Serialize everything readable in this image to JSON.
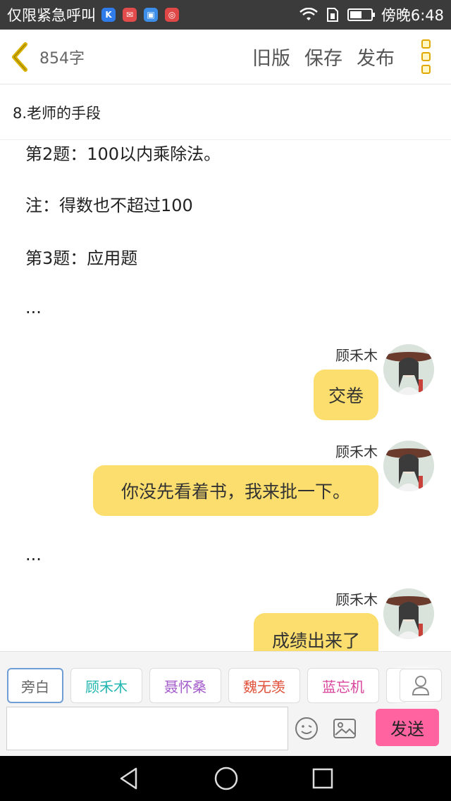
{
  "status_bar": {
    "carrier": "仅限紧急呼叫",
    "app_icons": [
      "k-app-icon",
      "mail-icon",
      "gallery-icon",
      "app-icon"
    ],
    "time": "傍晚6:48"
  },
  "toolbar": {
    "word_count": "854字",
    "old_version": "旧版",
    "save": "保存",
    "publish": "发布"
  },
  "chapter_title": "8.老师的手段",
  "content": {
    "lines": [
      "第2题：100以内乘除法。",
      "注：得数也不超过100",
      "第3题：应用题",
      "...",
      "..."
    ],
    "messages": [
      {
        "name": "顾禾木",
        "text": "交卷"
      },
      {
        "name": "顾禾木",
        "text": "你没先看着书，我来批一下。"
      },
      {
        "name": "顾禾木",
        "text": "成绩出来了"
      }
    ]
  },
  "roles": [
    {
      "label": "旁白",
      "color": "#666666"
    },
    {
      "label": "顾禾木",
      "color": "#22b6b0"
    },
    {
      "label": "聂怀桑",
      "color": "#a35acb"
    },
    {
      "label": "魏无羡",
      "color": "#e0523b"
    },
    {
      "label": "蓝忘机",
      "color": "#d9459c"
    }
  ],
  "input": {
    "placeholder": ""
  },
  "send_label": "发送",
  "colors": {
    "accent": "#ff64a1",
    "bubble": "#fbde6d",
    "back": "#d9b200"
  }
}
